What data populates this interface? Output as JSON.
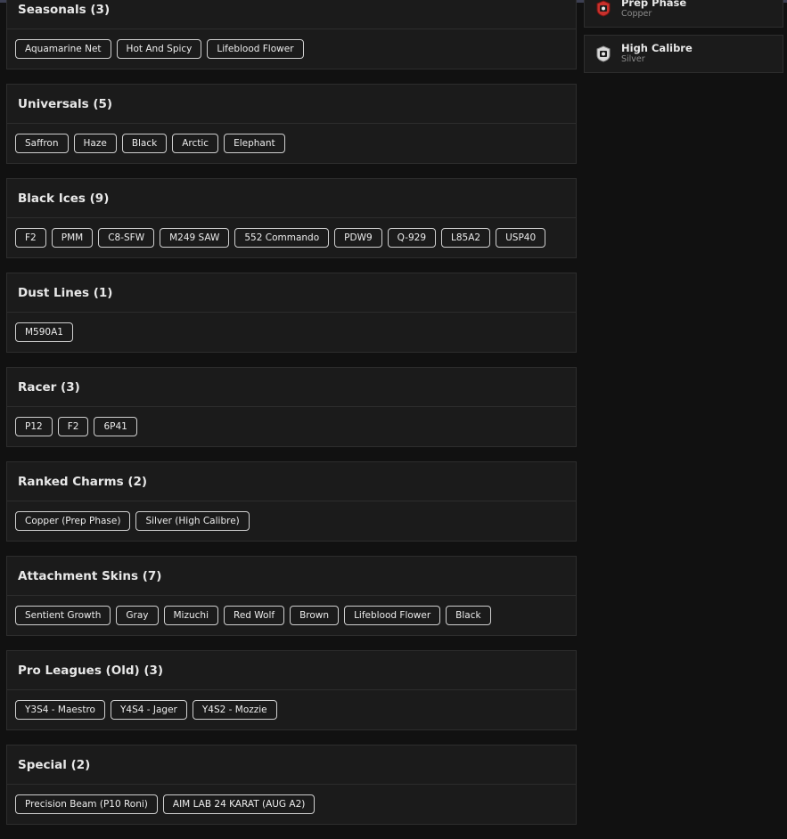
{
  "sidebar": {
    "charms": [
      {
        "title": "Prep Phase",
        "subtitle": "Copper",
        "icon": "copper-rank-badge-icon",
        "color": "#c8312c"
      },
      {
        "title": "High Calibre",
        "subtitle": "Silver",
        "icon": "silver-rank-badge-icon",
        "color": "#d9d9d9"
      }
    ]
  },
  "sections": [
    {
      "title": "Seasonals (3)",
      "items": [
        "Aquamarine Net",
        "Hot And Spicy",
        "Lifeblood Flower"
      ]
    },
    {
      "title": "Universals (5)",
      "items": [
        "Saffron",
        "Haze",
        "Black",
        "Arctic",
        "Elephant"
      ]
    },
    {
      "title": "Black Ices (9)",
      "items": [
        "F2",
        "PMM",
        "C8-SFW",
        "M249 SAW",
        "552 Commando",
        "PDW9",
        "Q-929",
        "L85A2",
        "USP40"
      ]
    },
    {
      "title": "Dust Lines (1)",
      "items": [
        "M590A1"
      ]
    },
    {
      "title": "Racer (3)",
      "items": [
        "P12",
        "F2",
        "6P41"
      ]
    },
    {
      "title": "Ranked Charms (2)",
      "items": [
        "Copper (Prep Phase)",
        "Silver (High Calibre)"
      ]
    },
    {
      "title": "Attachment Skins (7)",
      "items": [
        "Sentient Growth",
        "Gray",
        "Mizuchi",
        "Red Wolf",
        "Brown",
        "Lifeblood Flower",
        "Black"
      ]
    },
    {
      "title": "Pro Leagues (Old) (3)",
      "items": [
        "Y3S4 - Maestro",
        "Y4S4 - Jager",
        "Y4S2 - Mozzie"
      ]
    },
    {
      "title": "Special (2)",
      "items": [
        "Precision Beam (P10 Roni)",
        "AIM LAB 24 KARAT (AUG A2)"
      ]
    }
  ]
}
